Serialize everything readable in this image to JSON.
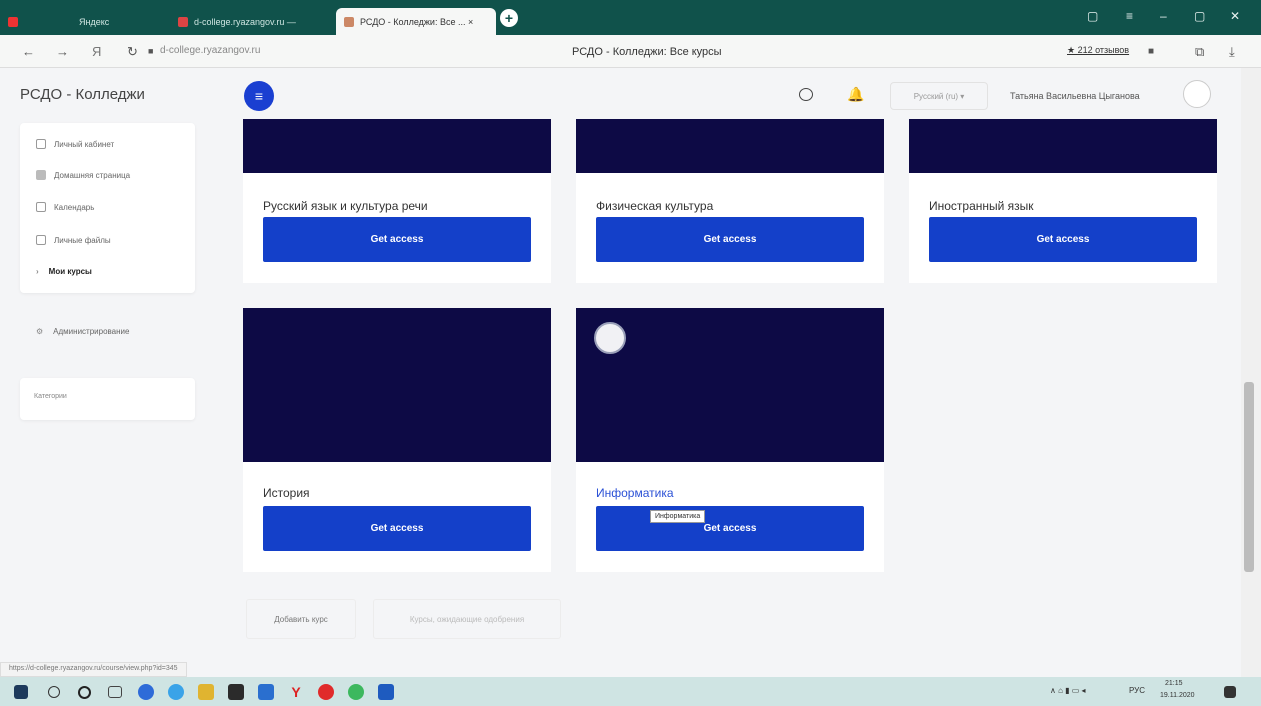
{
  "browser": {
    "tabs": [
      {
        "label": "Яндекс",
        "active": false
      },
      {
        "label": "d-college.ryazangov.ru —",
        "active": false
      },
      {
        "label": "РСДО - Колледжи: Все ... ×",
        "active": true
      }
    ],
    "url": "d-college.ryazangov.ru",
    "page_title": "РСДО - Колледжи: Все курсы",
    "reviews": "★ 212 отзывов"
  },
  "app": {
    "brand": "РСДО - Колледжи",
    "language": "Русский (ru) ▾",
    "user_name": "Татьяна Васильевна Цыганова"
  },
  "sidebar": {
    "items": [
      {
        "label": "Личный кабинет"
      },
      {
        "label": "Домашняя страница"
      },
      {
        "label": "Календарь"
      },
      {
        "label": "Личные файлы"
      },
      {
        "label": "Мои курсы"
      }
    ],
    "admin_label": "Администрирование",
    "categories_label": "Категории"
  },
  "courses": [
    {
      "name": "Русский язык и культура речи",
      "button": "Get access"
    },
    {
      "name": "Физическая культура",
      "button": "Get access"
    },
    {
      "name": "Иностранный язык",
      "button": "Get access"
    },
    {
      "name": "История",
      "button": "Get access"
    },
    {
      "name": "Информатика",
      "button": "Get access"
    }
  ],
  "tooltip": "Информатика",
  "actions": {
    "add_course": "Добавить курс",
    "pending_courses": "Курсы, ожидающие одобрения"
  },
  "status_url": "https://d-college.ryazangov.ru/course/view.php?id=345",
  "taskbar": {
    "lang": "РУС",
    "time": "21:15",
    "date": "19.11.2020"
  }
}
